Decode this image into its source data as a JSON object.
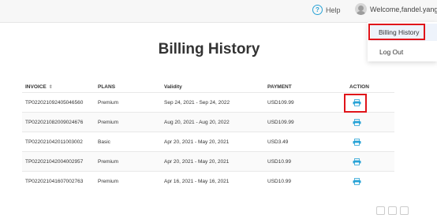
{
  "header": {
    "help_label": "Help",
    "help_icon": "?",
    "welcome": "Welcome,fandel.yang",
    "chevron": "⌄"
  },
  "menu": {
    "items": [
      {
        "label": "Billing History"
      },
      {
        "label": "Log Out"
      }
    ]
  },
  "page": {
    "title": "Billing History"
  },
  "table": {
    "columns": [
      "INVOICE",
      "PLANS",
      "Validity",
      "PAYMENT",
      "ACTION"
    ],
    "sort_icon": "⇕",
    "rows": [
      {
        "invoice": "TP022021092405046560",
        "plan": "Premium",
        "validity": "Sep 24, 2021 - Sep 24, 2022",
        "payment": "USD109.99"
      },
      {
        "invoice": "TP022021082009024676",
        "plan": "Premium",
        "validity": "Aug 20, 2021 - Aug 20, 2022",
        "payment": "USD109.99"
      },
      {
        "invoice": "TP022021042011003002",
        "plan": "Basic",
        "validity": "Apr 20, 2021 - May 20, 2021",
        "payment": "USD3.49"
      },
      {
        "invoice": "TP022021042004002957",
        "plan": "Premium",
        "validity": "Apr 20, 2021 - May 20, 2021",
        "payment": "USD10.99"
      },
      {
        "invoice": "TP022021041607002763",
        "plan": "Premium",
        "validity": "Apr 16, 2021 - May 16, 2021",
        "payment": "USD10.99"
      }
    ]
  },
  "colors": {
    "accent": "#29a3d6",
    "highlight": "#e0141a"
  },
  "icons": {
    "help": "help-icon",
    "avatar": "avatar-icon",
    "print": "print-icon"
  }
}
